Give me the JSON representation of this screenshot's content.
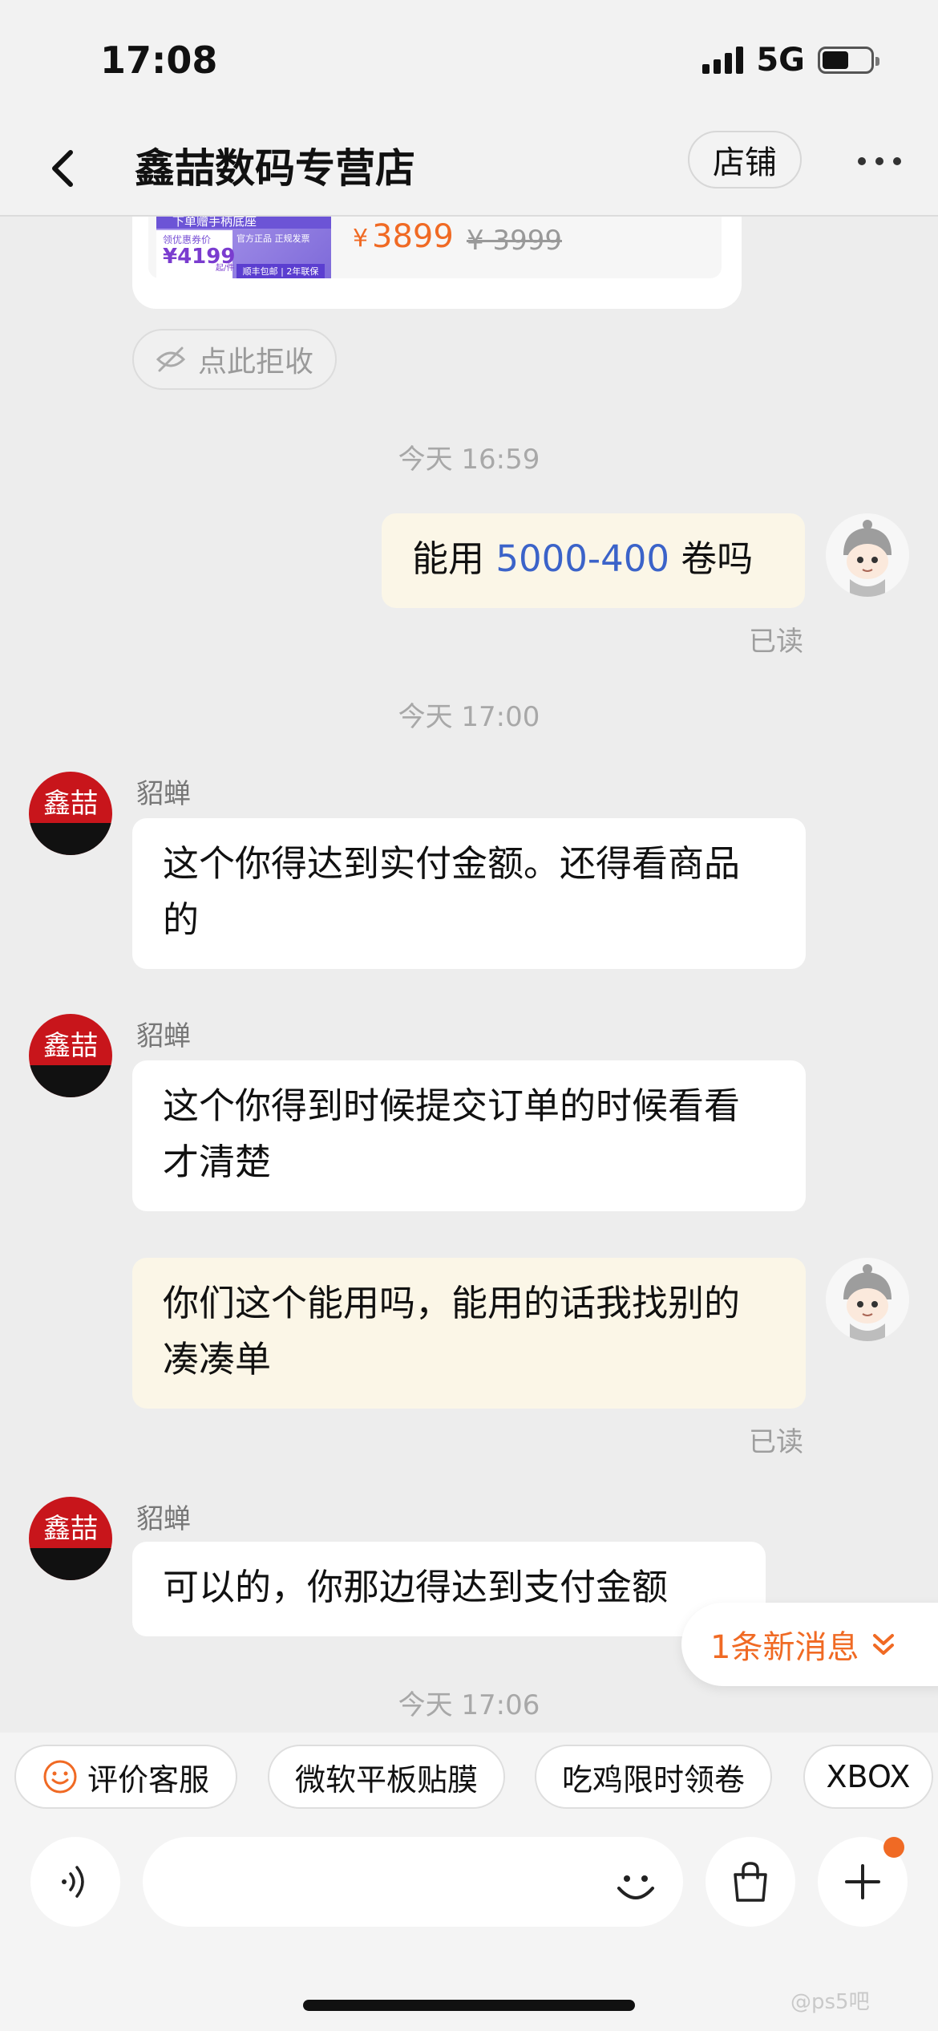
{
  "status_bar": {
    "time": "17:08",
    "network": "5G"
  },
  "header": {
    "title": "鑫喆数码专营店",
    "store_button": "店铺"
  },
  "product": {
    "thumb_banner": "下单赠手柄底座",
    "thumb_price_label": "领优惠券价",
    "thumb_price": "¥4199",
    "thumb_price_unit": "起/件",
    "thumb_badge1": "官方正品 正规发票",
    "thumb_badge2": "顺丰包邮 | 2年联保",
    "currency": "¥",
    "price": "3899",
    "original_price": "¥ 3999"
  },
  "reject_label": "点此拒收",
  "messages": {
    "time1": "今天 16:59",
    "user_msg1_pre": "能用 ",
    "user_msg1_num": "5000-400",
    "user_msg1_post": " 卷吗",
    "read1": "已读",
    "time2": "今天 17:00",
    "shop_name": "貂蝉",
    "shop_msg1": "这个你得达到实付金额。还得看商品的",
    "shop_msg2": "这个你得到时候提交订单的时候看看才清楚",
    "user_msg2": "你们这个能用吗，能用的话我找别的凑凑单",
    "read2": "已读",
    "shop_msg3": "可以的，你那边得达到支付金额",
    "time3": "今天 17:06",
    "shop_avatar_text": "鑫喆"
  },
  "new_message_badge": "1条新消息",
  "quick_chips": [
    "评价客服",
    "微软平板贴膜",
    "吃鸡限时领卷",
    "XBOX"
  ],
  "watermark": "@ps5吧",
  "colors": {
    "accent_orange": "#f06a24",
    "link_blue": "#3b63c9",
    "bubble_self": "#fbf6e7"
  }
}
